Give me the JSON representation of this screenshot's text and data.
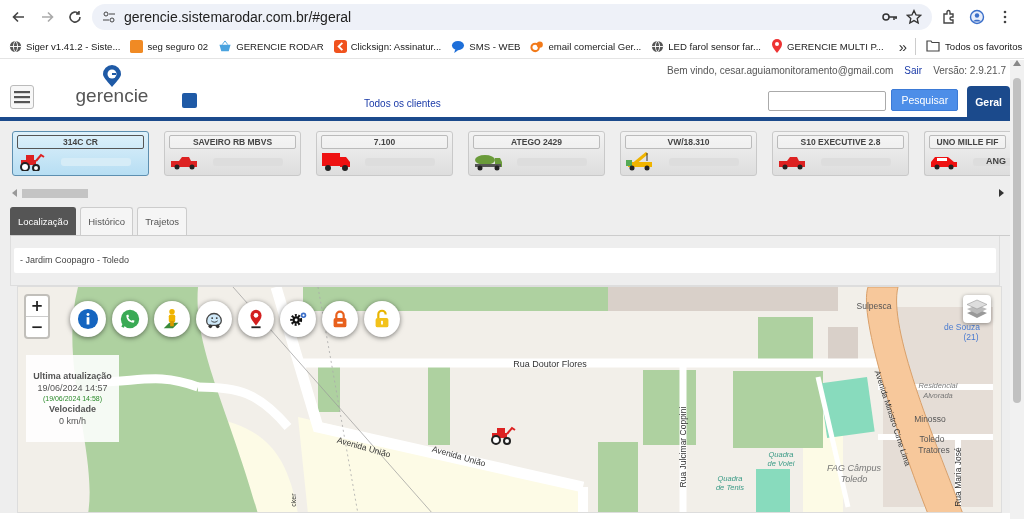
{
  "browser": {
    "url": "gerencie.sistemarodar.com.br/#geral",
    "bookmarks": [
      {
        "label": "Siger v1.41.2 - Siste...",
        "kind": "globe"
      },
      {
        "label": "seg seguro 02",
        "kind": "tile"
      },
      {
        "label": "GERENCIE RODAR",
        "kind": "basket"
      },
      {
        "label": "Clicksign: Assinatur...",
        "kind": "arrow"
      },
      {
        "label": "SMS - WEB",
        "kind": "bubble"
      },
      {
        "label": "email comercial Ger...",
        "kind": "cp"
      },
      {
        "label": "LED farol sensor far...",
        "kind": "globe"
      },
      {
        "label": "GERENCIE MULTI P...",
        "kind": "pin"
      }
    ],
    "overflow": "»",
    "all_bookmarks": "Todos os favoritos"
  },
  "header": {
    "logo": "gerencie",
    "welcome": "Bem vindo, cesar.aguiamonitoramento@gmail.com",
    "logout": "Sair",
    "version": "Versão: 2.9.21.7",
    "client_filter": "Todos os clientes",
    "search_button": "Pesquisar",
    "tab": "Geral"
  },
  "vehicles": [
    {
      "name": "314C CR",
      "kind": "tractor",
      "selected": true
    },
    {
      "name": "SAVEIRO RB MBVS",
      "kind": "pickup",
      "selected": false
    },
    {
      "name": "7.100",
      "kind": "truck",
      "selected": false
    },
    {
      "name": "ATEGO 2429",
      "kind": "mixer",
      "selected": false
    },
    {
      "name": "VW/18.310",
      "kind": "crane",
      "selected": false
    },
    {
      "name": "S10 EXECUTIVE 2.8",
      "kind": "pickup",
      "selected": false
    },
    {
      "name": "UNO MILLE FIF",
      "kind": "car",
      "selected": false,
      "extra": "ANG"
    }
  ],
  "tabs": [
    {
      "label": "Localização",
      "selected": true
    },
    {
      "label": "Histórico",
      "selected": false
    },
    {
      "label": "Trajetos",
      "selected": false
    }
  ],
  "address": "- Jardim Coopagro - Toledo",
  "map": {
    "zoom_in": "+",
    "zoom_out": "−",
    "actions": [
      {
        "kind": "info"
      },
      {
        "kind": "chat"
      },
      {
        "kind": "person"
      },
      {
        "kind": "smiley"
      },
      {
        "kind": "pin"
      },
      {
        "kind": "gear"
      },
      {
        "kind": "lock"
      },
      {
        "kind": "unlock"
      }
    ],
    "info": {
      "title": "Ultima atualização",
      "time": "19/06/2024 14:57",
      "received": "(19/06/2024 14:58)",
      "speed_label": "Velocidade",
      "speed": "0 km/h"
    },
    "labels": [
      {
        "text": "Rua Doutor Flores",
        "kind": "street"
      },
      {
        "text": "Avenida União",
        "kind": "street"
      },
      {
        "text": "Avenida União",
        "kind": "street"
      },
      {
        "text": "Rua Julcimar Coppini",
        "kind": "street"
      },
      {
        "text": "Avenida Ministro Cirne Lima",
        "kind": "street"
      },
      {
        "text": "Rua Maria José",
        "kind": "street"
      },
      {
        "text": "cker",
        "kind": "street"
      },
      {
        "text": "Sulpesca",
        "kind": "place"
      },
      {
        "text": "de Souza",
        "kind": "poi"
      },
      {
        "text": "(21)",
        "kind": "poi"
      },
      {
        "text": "Residencial",
        "kind": "area"
      },
      {
        "text": "Alvorada",
        "kind": "area"
      },
      {
        "text": "Minosso",
        "kind": "place"
      },
      {
        "text": "Toledo",
        "kind": "place"
      },
      {
        "text": "Tratores",
        "kind": "place"
      },
      {
        "text": "Quadra",
        "kind": "sport"
      },
      {
        "text": "de Volei",
        "kind": "sport"
      },
      {
        "text": "Quadra",
        "kind": "sport"
      },
      {
        "text": "de Tenis",
        "kind": "sport"
      },
      {
        "text": "FAG Câmpus",
        "kind": "area"
      },
      {
        "text": "Toledo",
        "kind": "area"
      }
    ]
  }
}
